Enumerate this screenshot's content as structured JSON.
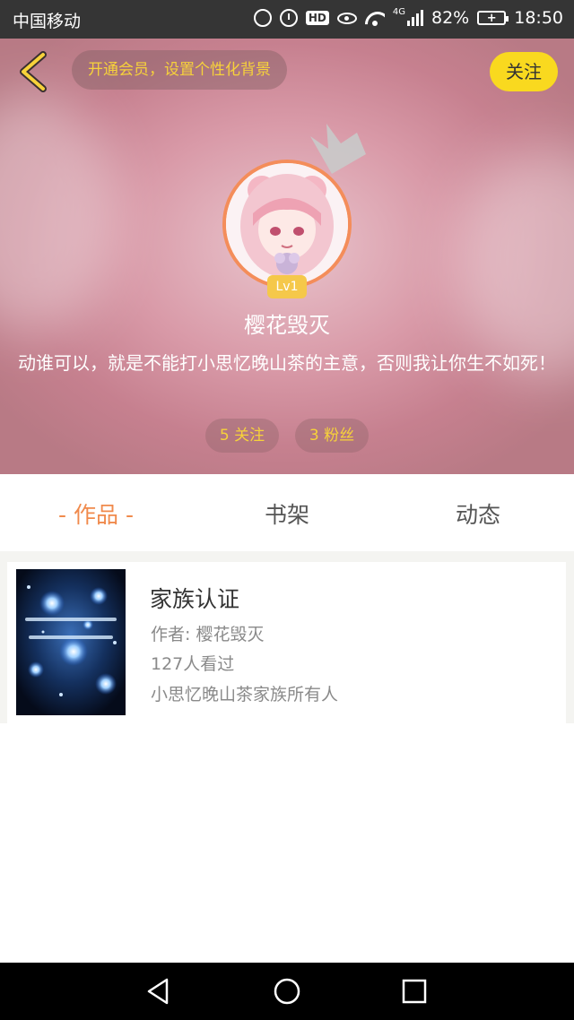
{
  "status_bar": {
    "carrier": "中国移动",
    "network": "4G",
    "battery": "82%",
    "battery_level": 0.82,
    "hd_badge": "HD",
    "time": "18:50",
    "icons": [
      "data-saver-icon",
      "alarm-icon",
      "hd-icon",
      "eye-comfort-icon",
      "wifi-icon",
      "signal-icon",
      "battery-icon"
    ]
  },
  "header": {
    "back_icon": "chevron-left-icon",
    "vip_prompt": "开通会员，设置个性化背景",
    "follow_button": "关注",
    "follow_color": "#f9d91f",
    "accent_color": "#f7d23a"
  },
  "profile": {
    "level": "Lv1",
    "username": "樱花毁灭",
    "bio": "动谁可以，就是不能打小思忆晚山茶的主意，否则我让你生不如死！",
    "follows": "5 关注",
    "fans": "3 粉丝",
    "avatar_border_color": "#f48d5a",
    "crown_icon": "crown-icon"
  },
  "tabs": [
    {
      "label": "- 作品 -",
      "active": true
    },
    {
      "label": "书架",
      "active": false
    },
    {
      "label": "动态",
      "active": false
    }
  ],
  "tab_active_color": "#f08a4c",
  "works": [
    {
      "title": "家族认证",
      "author": "作者: 樱花毁灭",
      "views": "127人看过",
      "description": "小思忆晚山茶家族所有人"
    }
  ],
  "nav_bar": {
    "icons": [
      "triangle-back-icon",
      "circle-home-icon",
      "square-recents-icon"
    ]
  }
}
